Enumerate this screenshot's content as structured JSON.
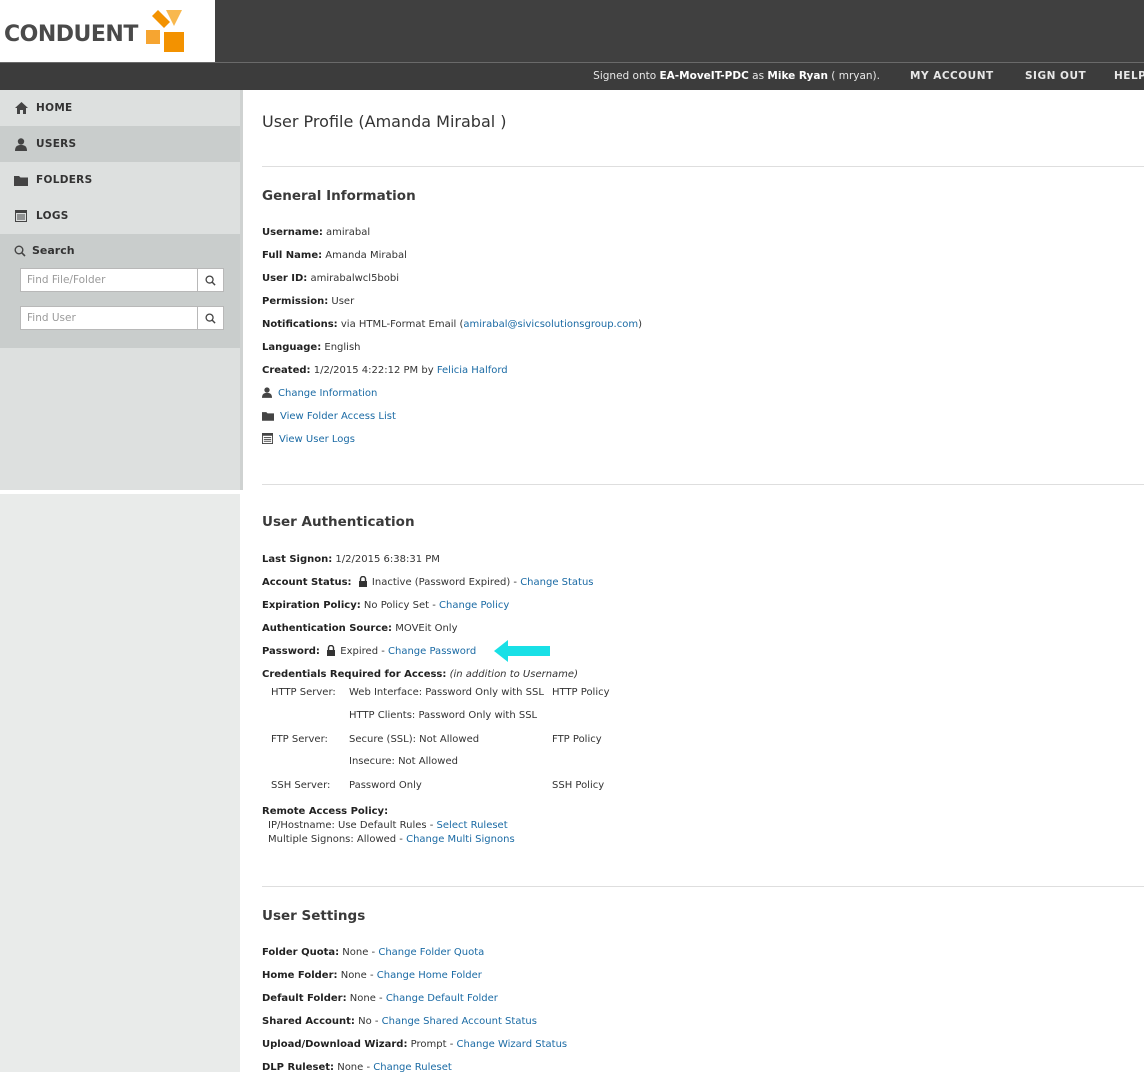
{
  "brand": {
    "name": "CONDUENT",
    "logo_color": "#f39200"
  },
  "header": {
    "signed_prefix": "Signed onto ",
    "server": "EA-MoveIT-PDC",
    "as_text": " as ",
    "user_name": "Mike Ryan",
    "user_suffix": " ( mryan).",
    "my_account": "MY ACCOUNT",
    "sign_out": "SIGN OUT",
    "help": "HELP"
  },
  "sidebar": {
    "items": [
      {
        "label": "HOME",
        "icon": "home-icon"
      },
      {
        "label": "USERS",
        "icon": "user-icon"
      },
      {
        "label": "FOLDERS",
        "icon": "folder-icon"
      },
      {
        "label": "LOGS",
        "icon": "logs-icon"
      }
    ],
    "search": {
      "title": "Search",
      "file_placeholder": "Find File/Folder",
      "user_placeholder": "Find User"
    }
  },
  "page": {
    "title": "User Profile (Amanda Mirabal )"
  },
  "general": {
    "title": "General Information",
    "username_label": "Username:",
    "username": " amirabal",
    "fullname_label": "Full Name:",
    "fullname": " Amanda Mirabal",
    "userid_label": "User ID:",
    "userid": " amirabalwcl5bobi",
    "permission_label": "Permission:",
    "permission": " User",
    "notifications_label": "Notifications:",
    "notifications_pre": "  via HTML-Format Email (",
    "notifications_email": "amirabal@sivicsolutionsgroup.com",
    "notifications_post": ")",
    "language_label": "Language:",
    "language": "  English",
    "created_label": "Created:",
    "created": "  1/2/2015 4:22:12 PM by ",
    "created_by": "Felicia Halford",
    "change_info": "Change Information",
    "folder_access": "View Folder Access List",
    "user_logs": "View User Logs"
  },
  "auth": {
    "title": "User Authentication",
    "last_signon_label": "Last Signon:",
    "last_signon": " 1/2/2015 6:38:31 PM",
    "status_label": "Account Status:",
    "status": " Inactive (Password Expired) - ",
    "change_status": "Change Status",
    "expiration_label": "Expiration Policy:",
    "expiration": " No Policy Set  -  ",
    "change_policy": "Change Policy",
    "source_label": "Authentication Source:",
    "source": " MOVEit Only",
    "password_label": "Password:",
    "password": " Expired - ",
    "change_password": "Change Password",
    "annotation_color": "#19e0e6",
    "creds_label": "Credentials Required for Access:",
    "creds_note": " (in addition to Username)",
    "http_server": "HTTP Server:",
    "http_web": "Web Interface: Password Only with SSL",
    "http_policy": "HTTP Policy",
    "http_clients": "HTTP Clients: Password Only with SSL",
    "ftp_server": "FTP Server:",
    "ftp_secure": "Secure (SSL): Not Allowed",
    "ftp_policy": "FTP Policy",
    "ftp_insecure": "Insecure: Not Allowed",
    "ssh_server": "SSH Server:",
    "ssh_value": "Password Only",
    "ssh_policy": "SSH Policy",
    "remote_label": "Remote Access Policy:",
    "ip_text": "IP/Hostname: Use Default Rules - ",
    "select_ruleset": "Select Ruleset",
    "multi_text": "Multiple Signons: Allowed - ",
    "change_multi": "Change Multi Signons"
  },
  "settings": {
    "title": "User Settings",
    "quota_label": "Folder Quota:",
    "quota": "  None - ",
    "quota_link": "Change Folder Quota",
    "home_label": "Home Folder:",
    "home": "  None - ",
    "home_link": "Change Home Folder",
    "default_label": "Default Folder:",
    "default": "  None - ",
    "default_link": "Change Default Folder",
    "shared_label": "Shared Account:",
    "shared": "  No - ",
    "shared_link": "Change Shared Account Status",
    "wizard_label": "Upload/Download Wizard:",
    "wizard": "  Prompt - ",
    "wizard_link": "Change Wizard Status",
    "dlp_label": "DLP Ruleset:",
    "dlp": "  None - ",
    "dlp_link": "Change Ruleset"
  }
}
